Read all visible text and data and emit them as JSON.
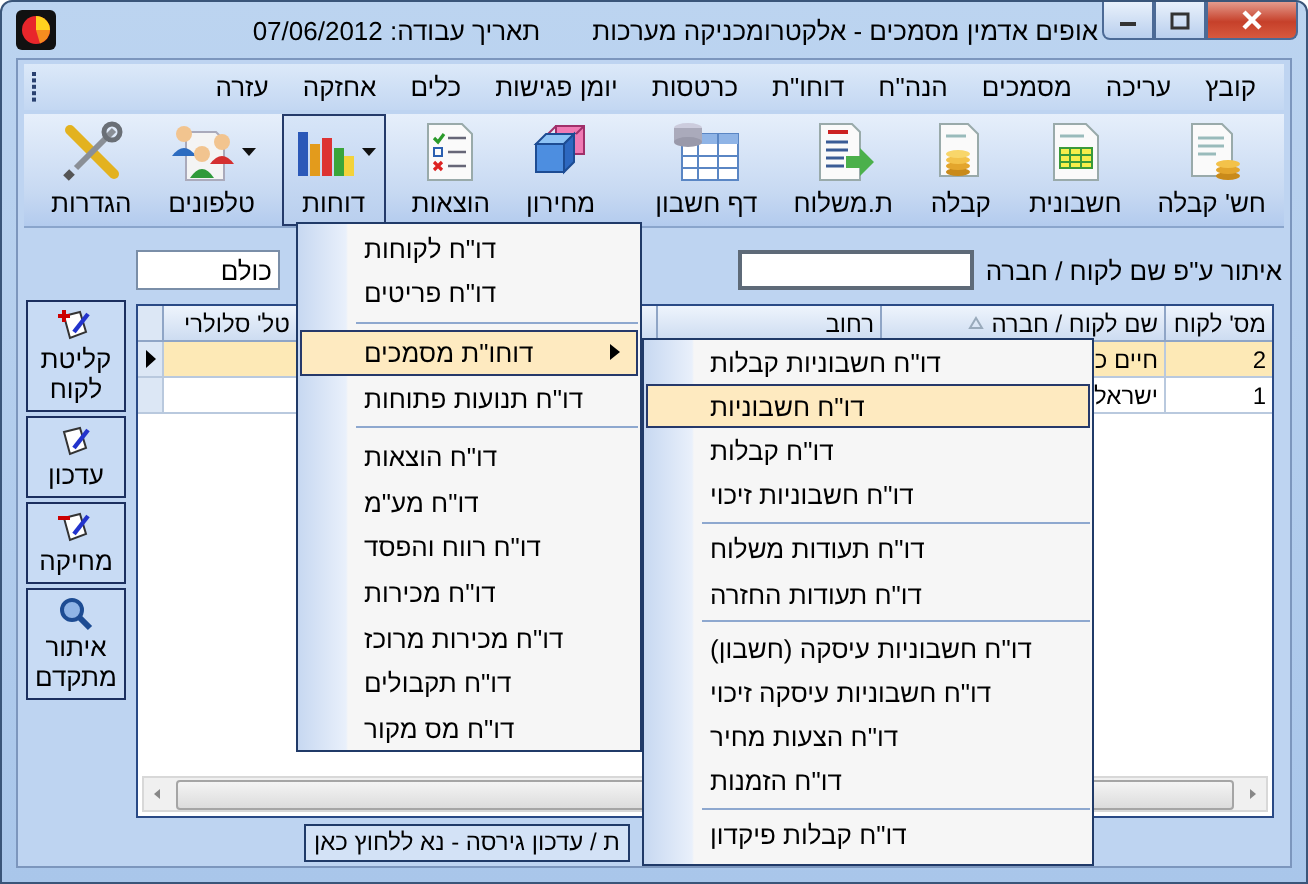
{
  "window": {
    "title": "אופים אדמין מסמכים - אלקטרומכניקה מערכות",
    "work_date": "תאריך עבודה: 07/06/2012"
  },
  "menu_bar": [
    "קובץ",
    "עריכה",
    "מסמכים",
    "הנה\"ח",
    "דוחו\"ת",
    "כרטסות",
    "יומן פגישות",
    "כלים",
    "אחזקה",
    "עזרה"
  ],
  "toolbar": {
    "groups": [
      [
        {
          "label": "חש' קבלה",
          "pressed": false,
          "dropdown": false
        },
        {
          "label": "חשבונית",
          "pressed": false,
          "dropdown": false
        },
        {
          "label": "קבלה",
          "pressed": false,
          "dropdown": false
        },
        {
          "label": "ת.משלוח",
          "pressed": false,
          "dropdown": false
        },
        {
          "label": "דף חשבון",
          "pressed": false,
          "dropdown": false
        }
      ],
      [
        {
          "label": "מחירון",
          "pressed": false,
          "dropdown": false
        },
        {
          "label": "הוצאות",
          "pressed": false,
          "dropdown": false
        },
        {
          "label": "דוחות",
          "pressed": true,
          "dropdown": true
        },
        {
          "label": "טלפונים",
          "pressed": false,
          "dropdown": true
        },
        {
          "label": "הגדרות",
          "pressed": false,
          "dropdown": false
        }
      ]
    ]
  },
  "side_buttons": [
    "קליטת לקוח",
    "עדכון",
    "מחיקה",
    "איתור מתקדם"
  ],
  "filter": {
    "scope_value": "כולם",
    "label": "איתור ע\"פ שם לקוח / חברה"
  },
  "table": {
    "columns": [
      {
        "label": "מס' לקוח",
        "sorted": false
      },
      {
        "label": "שם לקוח / חברה",
        "sorted": true
      },
      {
        "label": "רחוב",
        "sorted": false
      },
      {
        "label": "טל' סלולרי",
        "sorted": false
      }
    ],
    "rows": [
      {
        "number": "2",
        "name": "חיים כ",
        "selected": true
      },
      {
        "number": "1",
        "name": "ישראל",
        "selected": false
      }
    ]
  },
  "status_bar": "ת / עדכון גירסה - נא ללחוץ כאן",
  "reports_menu": {
    "items": [
      {
        "kind": "item",
        "label": "דו\"ח לקוחות",
        "selected": false,
        "submenu": false
      },
      {
        "kind": "item",
        "label": "דו\"ח פריטים",
        "selected": false,
        "submenu": false
      },
      {
        "kind": "separator"
      },
      {
        "kind": "item",
        "label": "דוחו\"ת מסמכים",
        "selected": true,
        "submenu": true
      },
      {
        "kind": "item",
        "label": "דו\"ח תנועות פתוחות",
        "selected": false,
        "submenu": false
      },
      {
        "kind": "separator"
      },
      {
        "kind": "item",
        "label": "דו\"ח הוצאות",
        "selected": false,
        "submenu": false
      },
      {
        "kind": "item",
        "label": "דו\"ח מע\"מ",
        "selected": false,
        "submenu": false
      },
      {
        "kind": "item",
        "label": "דו\"ח רווח והפסד",
        "selected": false,
        "submenu": false
      },
      {
        "kind": "item",
        "label": "דו\"ח מכירות",
        "selected": false,
        "submenu": false
      },
      {
        "kind": "item",
        "label": "דו\"ח מכירות מרוכז",
        "selected": false,
        "submenu": false
      },
      {
        "kind": "item",
        "label": "דו\"ח תקבולים",
        "selected": false,
        "submenu": false
      },
      {
        "kind": "item",
        "label": "דו\"ח מס מקור",
        "selected": false,
        "submenu": false
      }
    ]
  },
  "documents_submenu": {
    "items": [
      {
        "kind": "item",
        "label": "דו\"ח חשבוניות קבלות",
        "selected": false
      },
      {
        "kind": "item",
        "label": "דו\"ח חשבוניות",
        "selected": true
      },
      {
        "kind": "item",
        "label": "דו\"ח קבלות",
        "selected": false
      },
      {
        "kind": "item",
        "label": "דו\"ח חשבוניות זיכוי",
        "selected": false
      },
      {
        "kind": "separator"
      },
      {
        "kind": "item",
        "label": "דו\"ח תעודות משלוח",
        "selected": false
      },
      {
        "kind": "item",
        "label": "דו\"ח תעודות החזרה",
        "selected": false
      },
      {
        "kind": "separator"
      },
      {
        "kind": "item",
        "label": "דו\"ח חשבוניות עיסקה (חשבון)",
        "selected": false
      },
      {
        "kind": "item",
        "label": "דו\"ח חשבוניות עיסקה זיכוי",
        "selected": false
      },
      {
        "kind": "item",
        "label": "דו\"ח הצעות מחיר",
        "selected": false
      },
      {
        "kind": "item",
        "label": "דו\"ח הזמנות",
        "selected": false
      },
      {
        "kind": "separator"
      },
      {
        "kind": "item",
        "label": "דו\"ח קבלות פיקדון",
        "selected": false
      }
    ]
  }
}
